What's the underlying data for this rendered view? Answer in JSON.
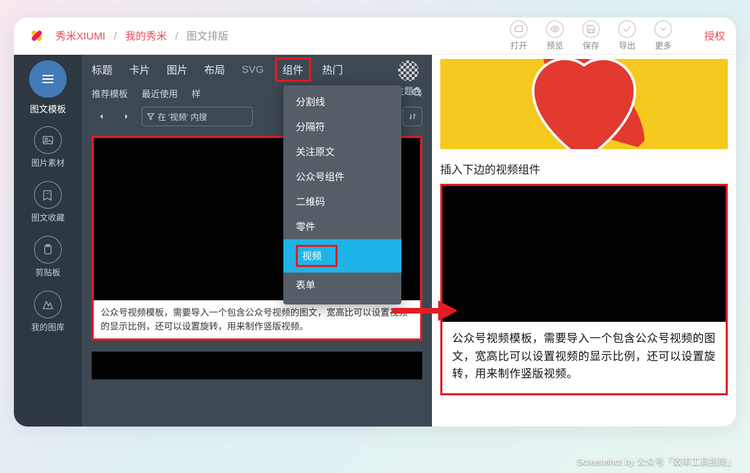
{
  "breadcrumbs": {
    "root": "秀米XIUMI",
    "mine": "我的秀米",
    "current": "图文排版"
  },
  "top_actions": {
    "open": "打开",
    "preview": "预览",
    "save": "保存",
    "export": "导出",
    "more": "更多"
  },
  "auth": "授权",
  "side": {
    "main": "图文模板",
    "items": [
      "图片素材",
      "图文收藏",
      "剪贴板",
      "我的图库"
    ]
  },
  "tabs1": [
    "标题",
    "卡片",
    "图片",
    "布局",
    "SVG",
    "组件",
    "热门"
  ],
  "tabs2": [
    "推荐模板",
    "最近使用",
    "样"
  ],
  "theme": "主题色",
  "search": {
    "placeholder": "在 '视频' 内搜"
  },
  "dropdown": [
    "分割线",
    "分隔符",
    "关注原文",
    "公众号组件",
    "二维码",
    "零件",
    "视频",
    "表单"
  ],
  "card_desc": "公众号视频模板，需要导入一个包含公众号视频的图文，宽高比可以设置视频的显示比例，还可以设置旋转，用来制作竖版视频。",
  "insert_label": "插入下边的视频组件",
  "right_desc": "公众号视频模板，需要导入一个包含公众号视频的图文，宽高比可以设置视频的显示比例，还可以设置旋转，用来制作竖版视频。",
  "watermark": "Screenshot by 公众号「效率工具指南」"
}
